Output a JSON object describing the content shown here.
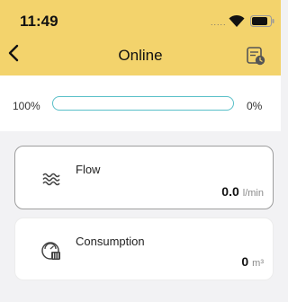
{
  "status_bar": {
    "time": "11:49",
    "signal_dots": "....."
  },
  "nav": {
    "title": "Online",
    "back_icon": "chevron-left-icon",
    "calendar_icon": "calendar-clock-icon"
  },
  "progress": {
    "left_label": "100%",
    "right_label": "0%",
    "fill_fraction": 0.0
  },
  "cards": {
    "flow": {
      "icon": "waves-icon",
      "label": "Flow",
      "value": "0.0",
      "unit": "l/min"
    },
    "consumption": {
      "icon": "meter-icon",
      "label": "Consumption",
      "value": "0",
      "unit": "m³"
    }
  },
  "colors": {
    "header": "#f3d36c",
    "background": "#f2f2f4",
    "progress": "#58bfc8"
  }
}
